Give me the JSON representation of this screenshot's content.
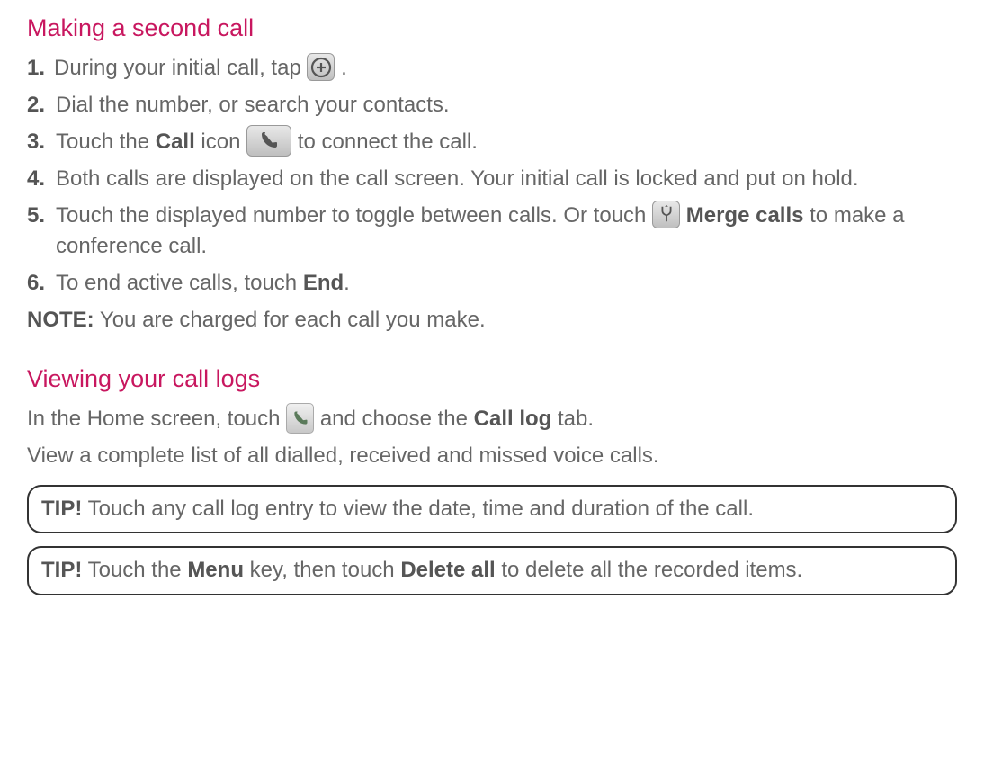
{
  "section1": {
    "heading": "Making a second call",
    "items": [
      {
        "num": "1.",
        "pre": " During your initial call, tap ",
        "post": " ."
      },
      {
        "num": "2.",
        "text": " Dial the number, or search your contacts."
      },
      {
        "num": "3.",
        "pre": " Touch the ",
        "bold1": "Call",
        "mid": " icon ",
        "post": " to connect the call."
      },
      {
        "num": "4.",
        "text": " Both calls are displayed on the call screen. Your initial call is locked and put on hold."
      },
      {
        "num": "5.",
        "pre": " Touch the displayed number to toggle between calls. Or touch ",
        "bold1": "Merge calls",
        "post": " to make a conference call."
      },
      {
        "num": "6.",
        "pre": " To end active calls, touch ",
        "bold1": "End",
        "post": "."
      }
    ],
    "note_label": "NOTE:",
    "note_text": " You are charged for each call you make."
  },
  "section2": {
    "heading": "Viewing your call logs",
    "p1_pre": "In the Home screen, touch ",
    "p1_mid": " and choose the ",
    "p1_bold": "Call log",
    "p1_post": " tab.",
    "p2": "View a complete list of all dialled, received and missed voice calls.",
    "tip1_label": "TIP!",
    "tip1_text": " Touch any call log entry to view the date, time and duration of the call.",
    "tip2_label": "TIP!",
    "tip2_pre": " Touch the ",
    "tip2_b1": "Menu",
    "tip2_mid": " key, then touch ",
    "tip2_b2": "Delete all",
    "tip2_post": " to delete all the recorded items."
  }
}
